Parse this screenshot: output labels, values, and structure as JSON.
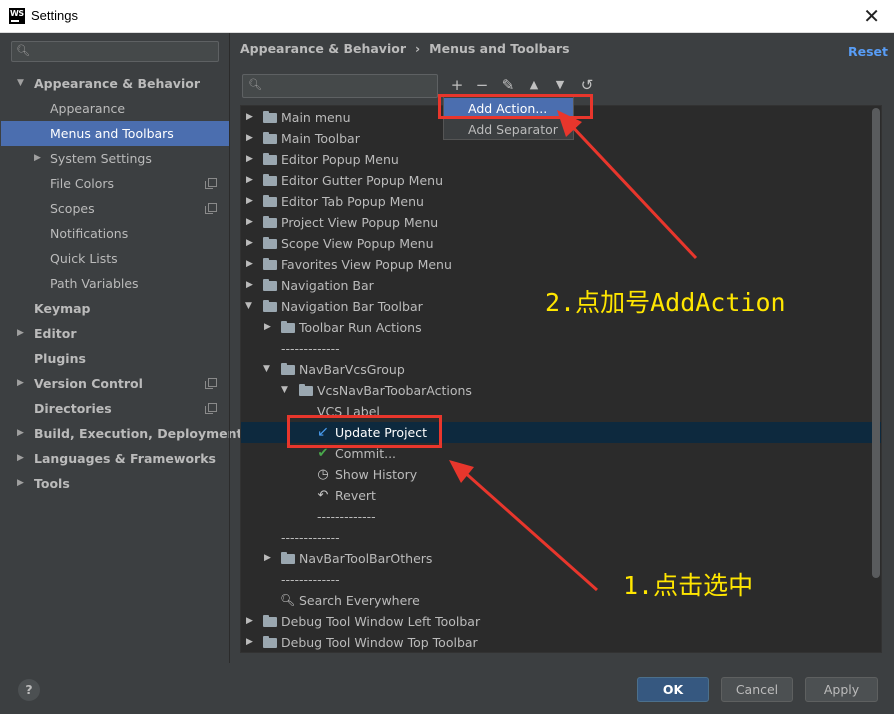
{
  "window": {
    "title": "Settings",
    "app_icon": "WS"
  },
  "sidebar": {
    "search_placeholder": "",
    "items": [
      {
        "label": "Appearance & Behavior"
      },
      {
        "label": "Appearance"
      },
      {
        "label": "Menus and Toolbars"
      },
      {
        "label": "System Settings"
      },
      {
        "label": "File Colors"
      },
      {
        "label": "Scopes"
      },
      {
        "label": "Notifications"
      },
      {
        "label": "Quick Lists"
      },
      {
        "label": "Path Variables"
      },
      {
        "label": "Keymap"
      },
      {
        "label": "Editor"
      },
      {
        "label": "Plugins"
      },
      {
        "label": "Version Control"
      },
      {
        "label": "Directories"
      },
      {
        "label": "Build, Execution, Deployment"
      },
      {
        "label": "Languages & Frameworks"
      },
      {
        "label": "Tools"
      }
    ],
    "selected": "Menus and Toolbars"
  },
  "breadcrumb": {
    "parent": "Appearance & Behavior",
    "separator": "›",
    "current": "Menus and Toolbars"
  },
  "reset_label": "Reset",
  "toolbar": {
    "add": "+",
    "remove": "−",
    "edit": "✎",
    "up": "▲",
    "down": "▼",
    "restore": "↺"
  },
  "tree": [
    {
      "label": "Main menu"
    },
    {
      "label": "Main Toolbar"
    },
    {
      "label": "Editor Popup Menu"
    },
    {
      "label": "Editor Gutter Popup Menu"
    },
    {
      "label": "Editor Tab Popup Menu"
    },
    {
      "label": "Project View Popup Menu"
    },
    {
      "label": "Scope View Popup Menu"
    },
    {
      "label": "Favorites View Popup Menu"
    },
    {
      "label": "Navigation Bar"
    },
    {
      "label": "Navigation Bar Toolbar"
    },
    {
      "label": "Toolbar Run Actions"
    },
    {
      "label": "-------------"
    },
    {
      "label": "NavBarVcsGroup"
    },
    {
      "label": "VcsNavBarToobarActions"
    },
    {
      "label": "VCS Label"
    },
    {
      "label": "Update Project"
    },
    {
      "label": "Commit..."
    },
    {
      "label": "Show History"
    },
    {
      "label": "Revert"
    },
    {
      "label": "-------------"
    },
    {
      "label": "-------------"
    },
    {
      "label": "NavBarToolBarOthers"
    },
    {
      "label": "-------------"
    },
    {
      "label": "Search Everywhere"
    },
    {
      "label": "Debug Tool Window Left Toolbar"
    },
    {
      "label": "Debug Tool Window Top Toolbar"
    }
  ],
  "popup": {
    "items": [
      {
        "label": "Add Action..."
      },
      {
        "label": "Add Separator"
      }
    ]
  },
  "annotations": {
    "step2": "2.点加号AddAction",
    "step1": "1.点击选中"
  },
  "buttons": {
    "help": "?",
    "ok": "OK",
    "cancel": "Cancel",
    "apply": "Apply"
  },
  "colors": {
    "selection": "#4b6eaf",
    "tree_selection": "#0d293e",
    "annotation_text": "#ffe600",
    "annotation_box": "#e8362c",
    "link": "#589df6"
  }
}
